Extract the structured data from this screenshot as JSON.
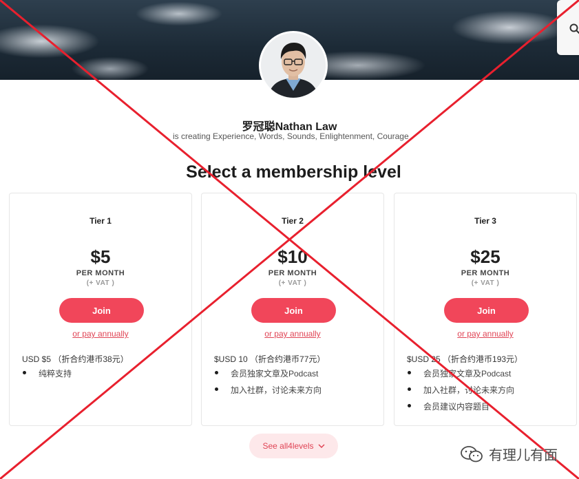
{
  "creator": {
    "name": "罗冠聪Nathan Law",
    "description": "is creating Experience, Words, Sounds, Enlightenment, Courage"
  },
  "section_title": "Select a membership level",
  "tiers": [
    {
      "name": "Tier 1",
      "price": "$5",
      "period": "PER MONTH",
      "vat": "(+ VAT )",
      "join_label": "Join",
      "annual_label": "or pay annually",
      "summary": "USD $5 （折合约港币38元）",
      "benefits": [
        "纯粹支持"
      ]
    },
    {
      "name": "Tier 2",
      "price": "$10",
      "period": "PER MONTH",
      "vat": "(+ VAT )",
      "join_label": "Join",
      "annual_label": "or pay annually",
      "summary": "$USD 10 （折合约港币77元）",
      "benefits": [
        "会员独家文章及Podcast",
        "加入社群，讨论未来方向"
      ]
    },
    {
      "name": "Tier 3",
      "price": "$25",
      "period": "PER MONTH",
      "vat": "(+ VAT )",
      "join_label": "Join",
      "annual_label": "or pay annually",
      "summary": "$USD 25 （折合约港币193元）",
      "benefits": [
        "会员独家文章及Podcast",
        "加入社群，讨论未来方向",
        "会员建议内容题目"
      ]
    }
  ],
  "see_all_label": "See all4levels",
  "watermark": "有理儿有面",
  "icons": {
    "search": "search-icon",
    "chevron": "chevron-down-icon",
    "wechat": "wechat-icon"
  },
  "colors": {
    "accent": "#f1465a",
    "link": "#e04455",
    "see_all_bg": "#fde8ea",
    "overlay_x": "#e8202e"
  }
}
